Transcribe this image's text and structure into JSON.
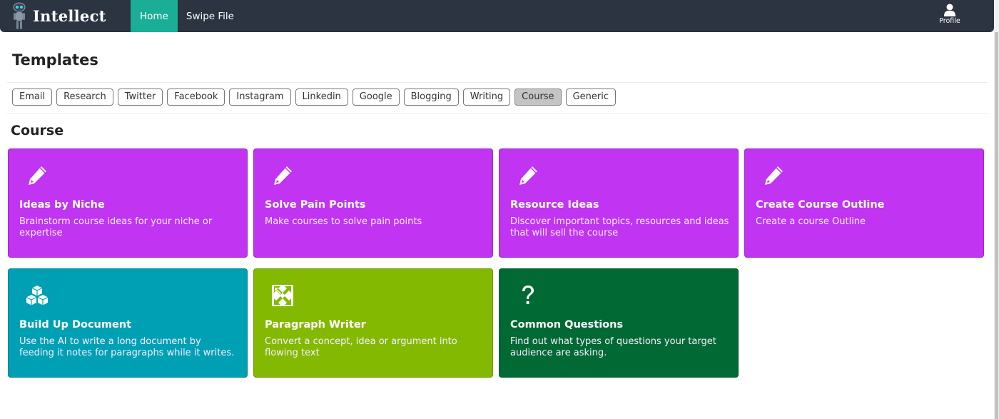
{
  "nav": {
    "brand": "Intellect",
    "links": [
      {
        "label": "Home",
        "active": true
      },
      {
        "label": "Swipe File",
        "active": false
      }
    ],
    "profile_label": "Profile"
  },
  "page": {
    "title": "Templates",
    "filters": [
      {
        "label": "Email",
        "active": false
      },
      {
        "label": "Research",
        "active": false
      },
      {
        "label": "Twitter",
        "active": false
      },
      {
        "label": "Facebook",
        "active": false
      },
      {
        "label": "Instagram",
        "active": false
      },
      {
        "label": "Linkedin",
        "active": false
      },
      {
        "label": "Google",
        "active": false
      },
      {
        "label": "Blogging",
        "active": false
      },
      {
        "label": "Writing",
        "active": false
      },
      {
        "label": "Course",
        "active": true
      },
      {
        "label": "Generic",
        "active": false
      }
    ],
    "section_title": "Course"
  },
  "colors": {
    "navbar": "#2b3440",
    "nav_active": "#1aae96",
    "purple": "#c034f2",
    "teal": "#00a0b4",
    "lime": "#84b902",
    "green": "#006934"
  },
  "cards": [
    {
      "title": "Ideas by Niche",
      "desc": "Brainstorm course ideas for your niche or expertise",
      "icon": "pencil-icon",
      "color": "#c034f2"
    },
    {
      "title": "Solve Pain Points",
      "desc": "Make courses to solve pain points",
      "icon": "pencil-icon",
      "color": "#c034f2"
    },
    {
      "title": "Resource Ideas",
      "desc": "Discover important topics, resources and ideas that will sell the course",
      "icon": "pencil-icon",
      "color": "#c034f2"
    },
    {
      "title": "Create Course Outline",
      "desc": "Create a course Outline",
      "icon": "pencil-icon",
      "color": "#c034f2"
    },
    {
      "title": "Build Up Document",
      "desc": "Use the AI to write a long document by feeding it notes for paragraphs while it writes.",
      "icon": "cubes-icon",
      "color": "#00a0b4"
    },
    {
      "title": "Paragraph Writer",
      "desc": "Convert a concept, idea or argument into flowing text",
      "icon": "expand-arrows-icon",
      "color": "#84b902"
    },
    {
      "title": "Common Questions",
      "desc": "Find out what types of questions your target audience are asking.",
      "icon": "question-icon",
      "color": "#006934"
    }
  ]
}
